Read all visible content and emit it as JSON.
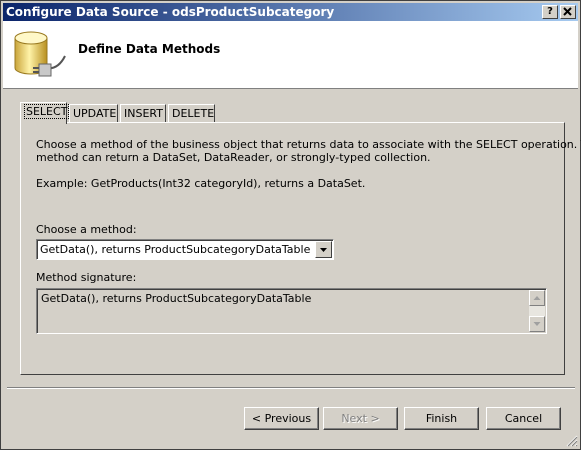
{
  "window": {
    "title": "Configure Data Source - odsProductSubcategory",
    "help_label": "?",
    "close_label": "X"
  },
  "header": {
    "title": "Define Data Methods",
    "icon": "database-plug-icon"
  },
  "tabs": [
    {
      "label": "SELECT",
      "active": true
    },
    {
      "label": "UPDATE",
      "active": false
    },
    {
      "label": "INSERT",
      "active": false
    },
    {
      "label": "DELETE",
      "active": false
    }
  ],
  "select_tab": {
    "description_line1": "Choose a method of the business object that returns data to associate with the SELECT operation. The",
    "description_line2": "method can return a DataSet, DataReader, or strongly-typed collection.",
    "example": "Example: GetProducts(Int32 categoryId), returns a DataSet.",
    "method_label": "Choose a method:",
    "method_value": "GetData(), returns ProductSubcategoryDataTable",
    "signature_label": "Method signature:",
    "signature_value": "GetData(), returns ProductSubcategoryDataTable"
  },
  "buttons": {
    "previous": "< Previous",
    "next": "Next >",
    "finish": "Finish",
    "cancel": "Cancel"
  },
  "colors": {
    "titlebar_start": "#0a246a",
    "titlebar_end": "#a6caf0",
    "face": "#d4d0c8"
  }
}
